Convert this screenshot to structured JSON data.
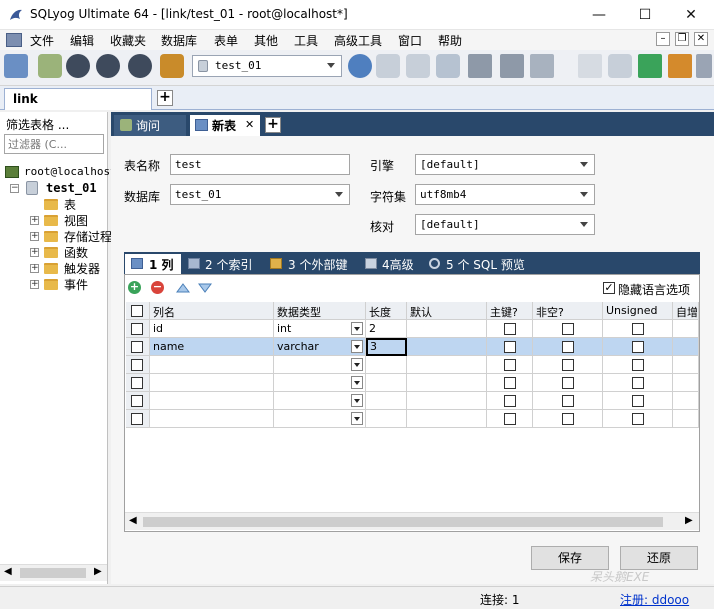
{
  "window": {
    "title": "SQLyog Ultimate 64 - [link/test_01 - root@localhost*]",
    "minimize": "—",
    "maximize": "☐",
    "close": "✕",
    "mdi_minimize": "–",
    "mdi_restore": "❐",
    "mdi_close": "✕"
  },
  "menu": [
    "文件",
    "编辑",
    "收藏夹",
    "数据库",
    "表单",
    "其他",
    "工具",
    "高级工具",
    "窗口",
    "帮助"
  ],
  "toolbar": {
    "database_value": "test_01"
  },
  "connection_tab": {
    "label": "link",
    "add": "+"
  },
  "left_panel": {
    "filter_label": "筛选表格 ...",
    "filter_placeholder": "过滤器 (C...",
    "tree": {
      "server": "root@localhost",
      "database": "test_01",
      "nodes": [
        "表",
        "视图",
        "存储过程",
        "函数",
        "触发器",
        "事件"
      ]
    }
  },
  "doc_tabs": [
    {
      "label": "询问",
      "icon": "query-icon",
      "active": false
    },
    {
      "label": "新表",
      "icon": "table-icon",
      "active": true
    }
  ],
  "doc_tab_close": "✕",
  "doc_tab_add": "+",
  "form": {
    "table_name_label": "表名称",
    "table_name_value": "test",
    "database_label": "数据库",
    "database_value": "test_01",
    "engine_label": "引擎",
    "engine_value": "[default]",
    "charset_label": "字符集",
    "charset_value": "utf8mb4",
    "collation_label": "核对",
    "collation_value": "[default]"
  },
  "sub_tabs": [
    "1 列",
    "2 个索引",
    "3 个外部键",
    "4高级",
    "5 个 SQL 预览"
  ],
  "hide_lang_options": {
    "label": "隐藏语言选项",
    "checked": true
  },
  "grid": {
    "headers": [
      "列名",
      "数据类型",
      "长度",
      "默认",
      "主键?",
      "非空?",
      "Unsigned",
      "自增"
    ],
    "rows": [
      {
        "name": "id",
        "type": "int",
        "length": "2",
        "selected": false
      },
      {
        "name": "name",
        "type": "varchar",
        "length": "3",
        "selected": true
      },
      {
        "name": "",
        "type": "",
        "length": "",
        "selected": false
      },
      {
        "name": "",
        "type": "",
        "length": "",
        "selected": false
      },
      {
        "name": "",
        "type": "",
        "length": "",
        "selected": false
      },
      {
        "name": "",
        "type": "",
        "length": "",
        "selected": false
      }
    ]
  },
  "buttons": {
    "save": "保存",
    "restore": "还原"
  },
  "watermark": "呆头鹅EXE",
  "status": {
    "connection": "连接: 1",
    "registration": "注册: ddooo"
  },
  "colors": {
    "navy_tab": "#29486b",
    "selected_row": "#bed6f1",
    "tab_active": "#ffffff"
  }
}
